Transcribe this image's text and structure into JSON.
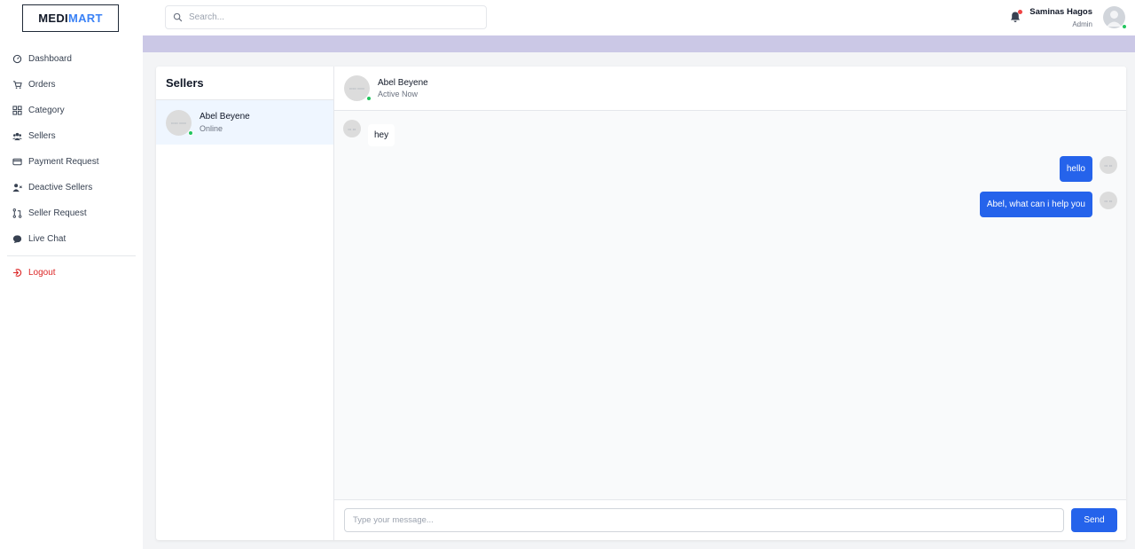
{
  "brand": {
    "part1": "MEDI",
    "part2": "MART"
  },
  "search": {
    "placeholder": "Search..."
  },
  "sidebar": {
    "items": [
      {
        "label": "Dashboard",
        "icon": "dashboard-icon"
      },
      {
        "label": "Orders",
        "icon": "cart-icon"
      },
      {
        "label": "Category",
        "icon": "grid-icon"
      },
      {
        "label": "Sellers",
        "icon": "users-icon"
      },
      {
        "label": "Payment Request",
        "icon": "card-icon"
      },
      {
        "label": "Deactive Sellers",
        "icon": "user-x-icon"
      },
      {
        "label": "Seller Request",
        "icon": "pull-request-icon"
      },
      {
        "label": "Live Chat",
        "icon": "chat-icon"
      }
    ],
    "logout": {
      "label": "Logout",
      "icon": "logout-icon"
    }
  },
  "user": {
    "name": "Saminas Hagos",
    "role": "Admin"
  },
  "colors": {
    "accent": "#2563eb",
    "banner": "#cbc8e6",
    "online": "#22c55e",
    "logout": "#dc2626"
  },
  "sellers_panel": {
    "title": "Sellers",
    "sellers": [
      {
        "name": "Abel Beyene",
        "status": "Online"
      }
    ]
  },
  "chat": {
    "header": {
      "name": "Abel Beyene",
      "status": "Active Now"
    },
    "messages": [
      {
        "from": "seller",
        "text": "hey"
      },
      {
        "from": "admin",
        "text": "hello"
      },
      {
        "from": "admin",
        "text": "Abel, what can i help you"
      }
    ],
    "composer": {
      "placeholder": "Type your message...",
      "send_label": "Send"
    }
  }
}
